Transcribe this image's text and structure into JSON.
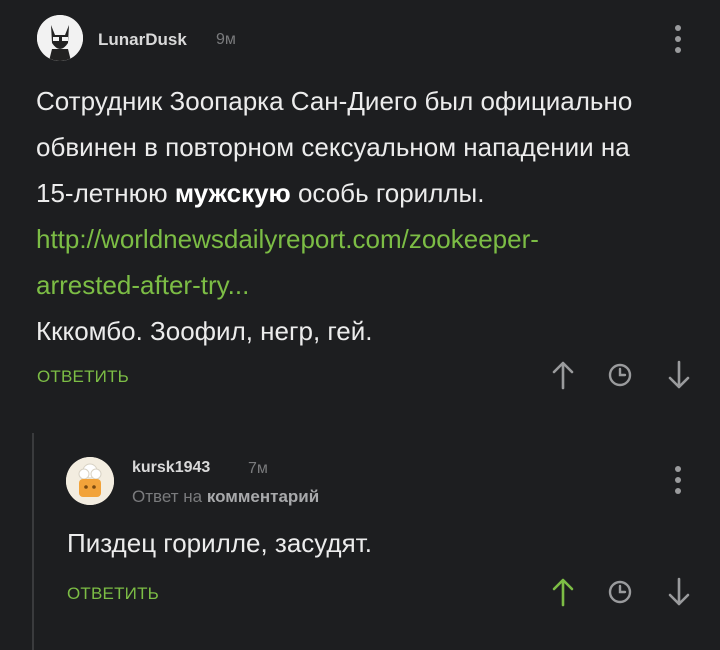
{
  "comments": [
    {
      "username": "LunarDusk",
      "time": "9м",
      "body": {
        "line1": "Сотрудник Зоопарка Сан-Диего был официально",
        "line2": "обвинен в повторном сексуальном нападении на",
        "line3_pre": "15-летнюю ",
        "line3_bold": "мужскую",
        "line3_post": " особь гориллы.",
        "link_line1": "http://worldnewsdailyreport.com/zookeeper-",
        "link_line2": "arrested-after-try...",
        "line_last": "Кккомбо. Зоофил, негр, гей."
      },
      "reply_label": "ОТВЕТИТЬ",
      "upvote_active": false
    },
    {
      "username": "kursk1943",
      "time": "7м",
      "reply_to_prefix": "Ответ на",
      "reply_to_target": "комментарий",
      "body": "Пиздец горилле, засудят.",
      "reply_label": "ОТВЕТИТЬ",
      "upvote_active": true
    }
  ],
  "colors": {
    "background": "#1d1e20",
    "accent_green": "#7cbd45",
    "icon_gray": "#9a9b9d"
  },
  "icons": [
    "more-vertical-icon",
    "arrow-up-icon",
    "clock-icon",
    "arrow-down-icon"
  ]
}
